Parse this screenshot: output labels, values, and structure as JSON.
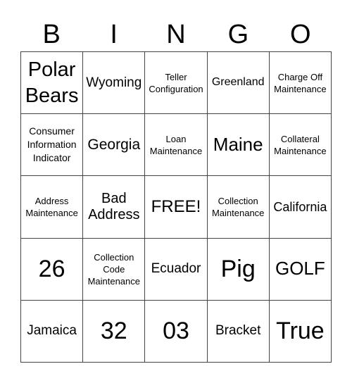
{
  "header": {
    "letters": [
      "B",
      "I",
      "N",
      "G",
      "O"
    ]
  },
  "cells": [
    [
      "Polar Bears",
      "Wyoming",
      "Teller Configuration",
      "Greenland",
      "Charge Off Maintenance"
    ],
    [
      "Consumer Information Indicator",
      "Georgia",
      "Loan Maintenance",
      "Maine",
      "Collateral Maintenance"
    ],
    [
      "Address Maintenance",
      "Bad Address",
      "FREE!",
      "Collection Maintenance",
      "California"
    ],
    [
      "26",
      "Collection Code Maintenance",
      "Ecuador",
      "Pig",
      "GOLF"
    ],
    [
      "Jamaica",
      "32",
      "03",
      "Bracket",
      "True"
    ]
  ]
}
